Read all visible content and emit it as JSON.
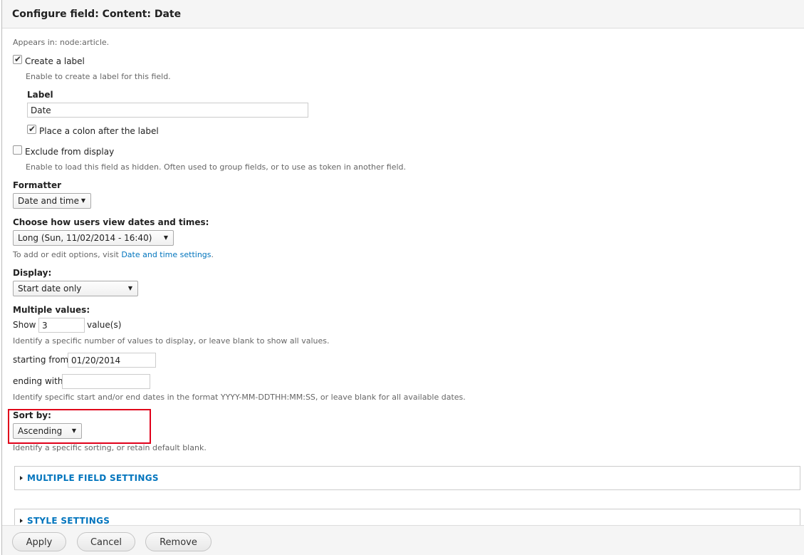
{
  "dialog": {
    "title": "Configure field: Content: Date",
    "appears_in": "Appears in: node:article."
  },
  "create_label": {
    "label": "Create a label",
    "checked": true,
    "description": "Enable to create a label for this field."
  },
  "label_field": {
    "title": "Label",
    "value": "Date",
    "colon_label": "Place a colon after the label",
    "colon_checked": true
  },
  "exclude": {
    "label": "Exclude from display",
    "checked": false,
    "description": "Enable to load this field as hidden. Often used to group fields, or to use as token in another field."
  },
  "formatter": {
    "title": "Formatter",
    "selected": "Date and time"
  },
  "date_format": {
    "title": "Choose how users view dates and times:",
    "selected": "Long (Sun, 11/02/2014 - 16:40)",
    "help_prefix": "To add or edit options, visit ",
    "help_link": "Date and time settings",
    "help_suffix": "."
  },
  "display": {
    "title": "Display:",
    "selected": "Start date only"
  },
  "multiple_values": {
    "title": "Multiple values:",
    "show_label": "Show",
    "show_value": "3",
    "values_suffix": "value(s)",
    "show_description": "Identify a specific number of values to display, or leave blank to show all values.",
    "starting_label": "starting from",
    "starting_value": "01/20/2014",
    "ending_label": "ending with",
    "ending_value": "",
    "dates_description": "Identify specific start and/or end dates in the format YYYY-MM-DDTHH:MM:SS, or leave blank for all available dates."
  },
  "sort_by": {
    "title": "Sort by:",
    "selected": "Ascending",
    "description": "Identify a specific sorting, or retain default blank."
  },
  "sections": {
    "multiple_field_settings": "MULTIPLE FIELD SETTINGS",
    "style_settings": "STYLE SETTINGS"
  },
  "buttons": {
    "apply": "Apply",
    "cancel": "Cancel",
    "remove": "Remove"
  },
  "colors": {
    "link": "#0074bd",
    "highlight_box": "#e0001a"
  }
}
